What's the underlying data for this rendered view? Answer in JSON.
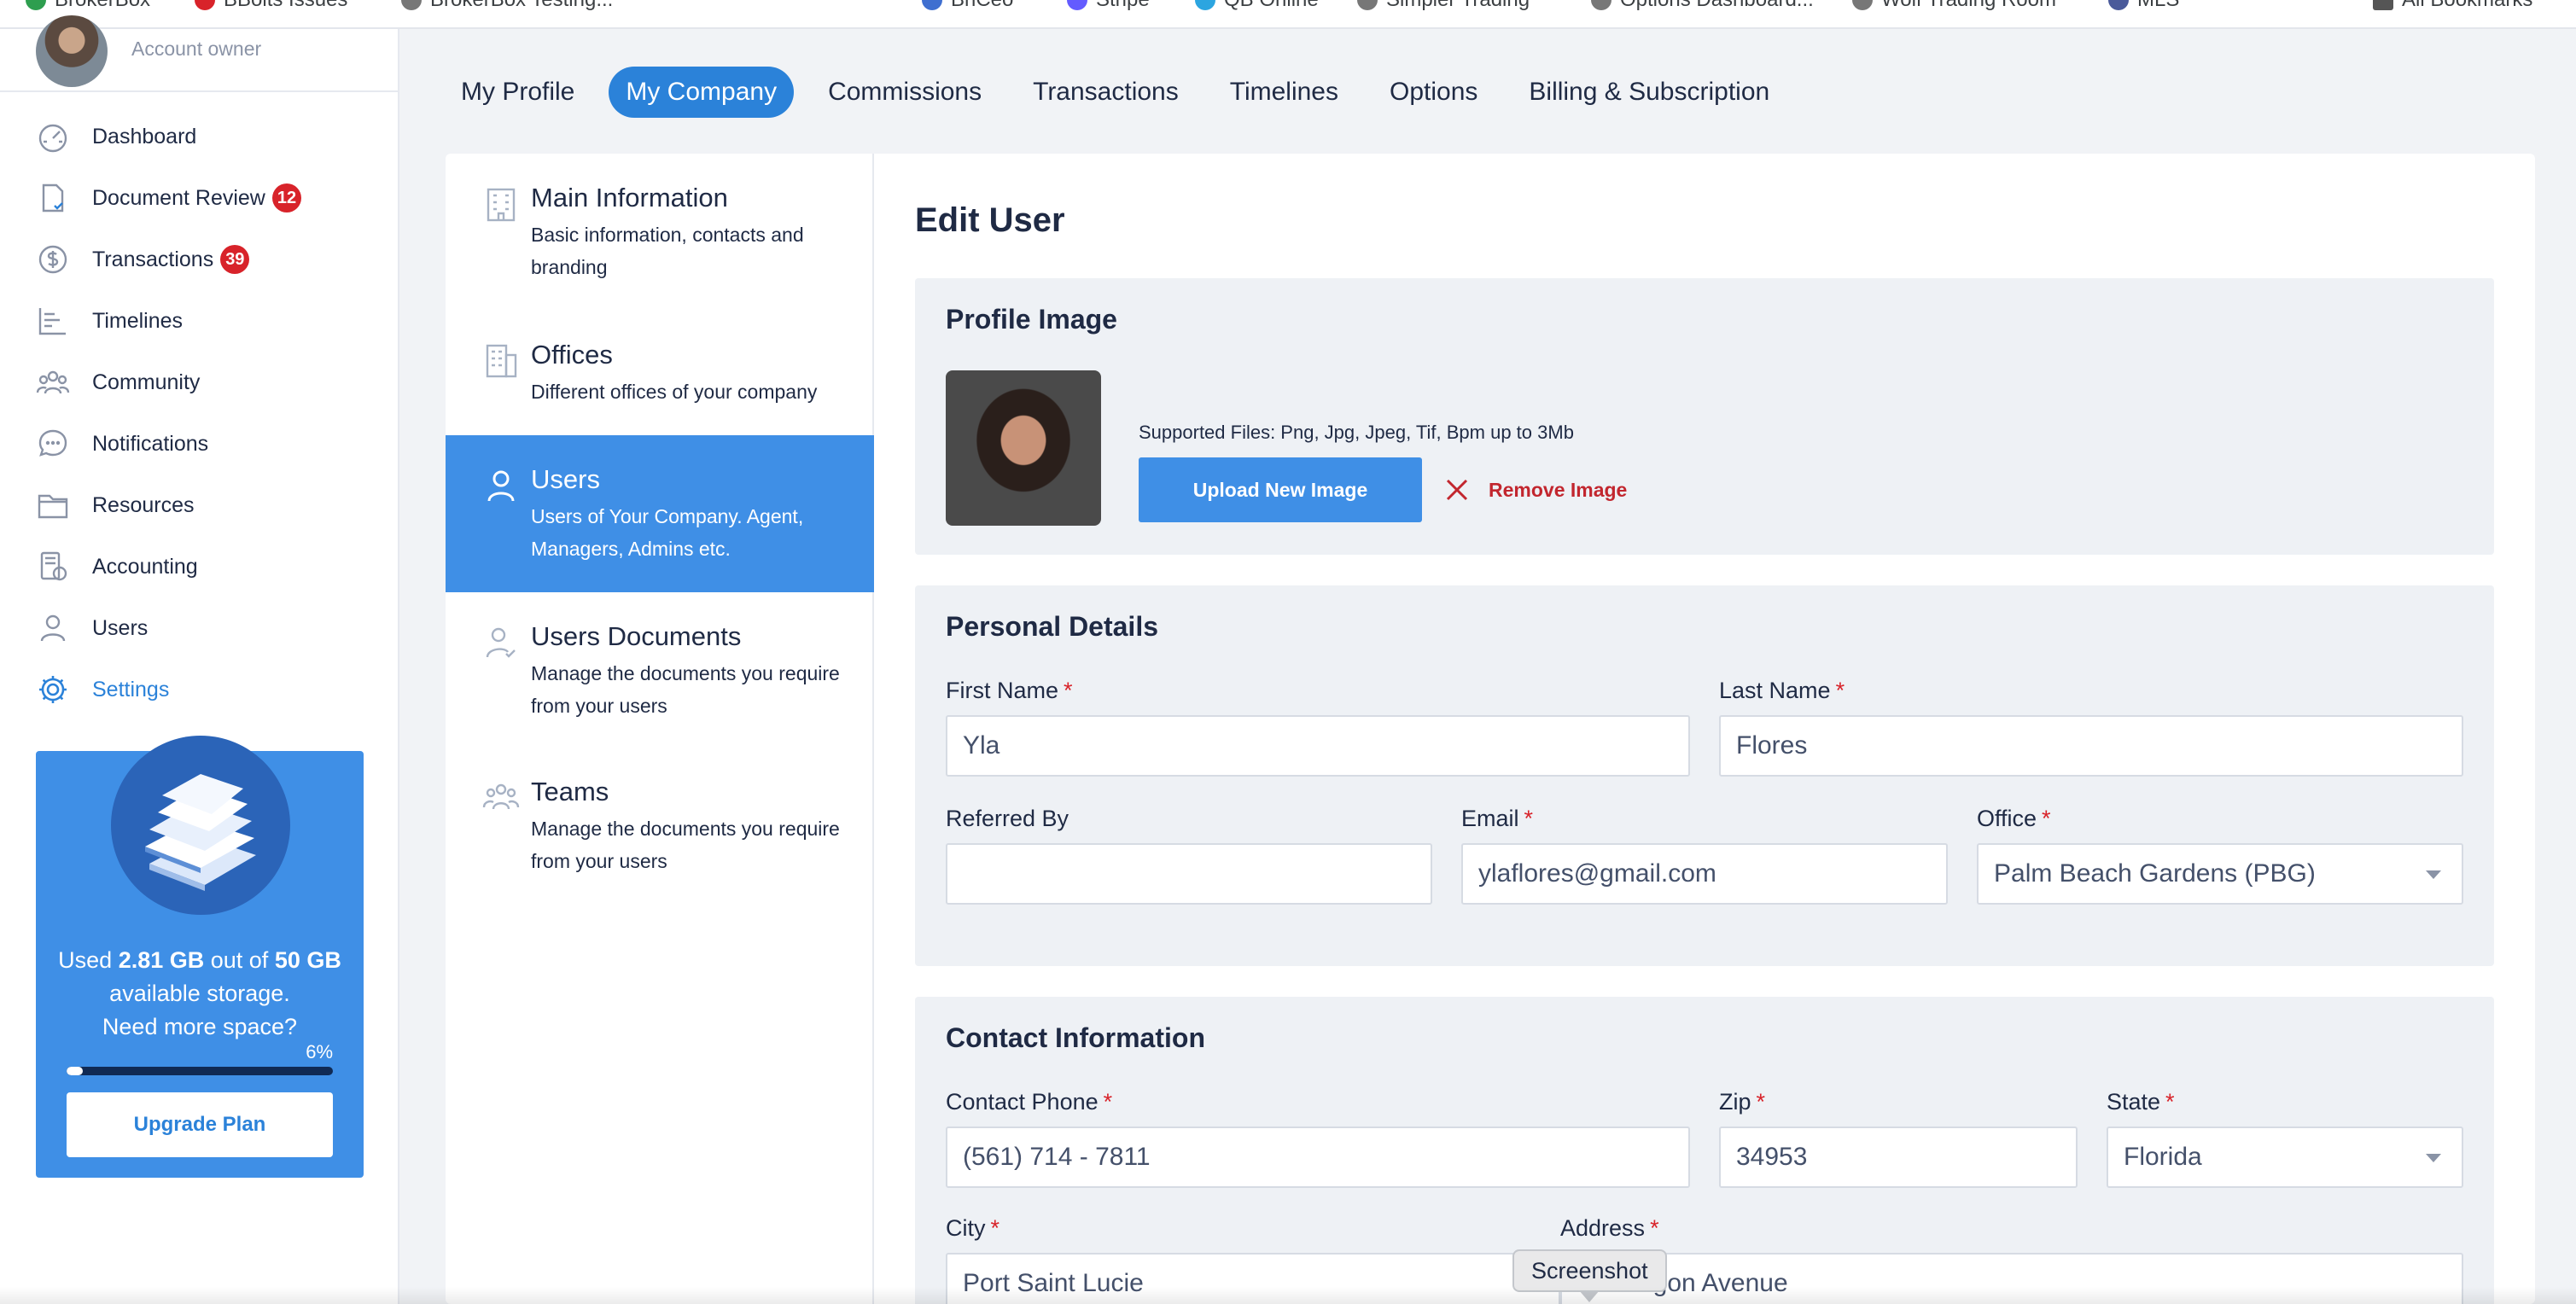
{
  "bookmarks": [
    "BrokerBox",
    "BBolts Issues",
    "BrokerBox Testing...",
    "BriCeo",
    "Stripe",
    "QB Online",
    "Simpler Trading",
    "Options Dashboard...",
    "Wolf Trading Room",
    "MLS",
    "All Bookmarks"
  ],
  "sidebar": {
    "account_role": "Account owner",
    "items": [
      {
        "label": "Dashboard",
        "icon": "dashboard-icon"
      },
      {
        "label": "Document Review",
        "icon": "document-check-icon",
        "badge": "12"
      },
      {
        "label": "Transactions",
        "icon": "dollar-icon",
        "badge": "39"
      },
      {
        "label": "Timelines",
        "icon": "timeline-icon"
      },
      {
        "label": "Community",
        "icon": "community-icon"
      },
      {
        "label": "Notifications",
        "icon": "chat-bubble-icon"
      },
      {
        "label": "Resources",
        "icon": "folder-icon"
      },
      {
        "label": "Accounting",
        "icon": "accounting-icon"
      },
      {
        "label": "Users",
        "icon": "user-icon"
      },
      {
        "label": "Settings",
        "icon": "gear-icon",
        "active": true
      }
    ],
    "storage": {
      "used_prefix": "Used ",
      "used": "2.81 GB",
      "of_text": " out of ",
      "total": "50 GB",
      "suffix": " available storage.",
      "need_more": "Need more space?",
      "percent_label": "6%",
      "percent": 6,
      "upgrade_label": "Upgrade Plan"
    }
  },
  "tabs": [
    {
      "label": "My Profile"
    },
    {
      "label": "My Company",
      "active": true
    },
    {
      "label": "Commissions"
    },
    {
      "label": "Transactions"
    },
    {
      "label": "Timelines"
    },
    {
      "label": "Options"
    },
    {
      "label": "Billing & Subscription"
    }
  ],
  "subnav": [
    {
      "title": "Main Information",
      "desc": "Basic information, contacts and branding",
      "icon": "building-icon"
    },
    {
      "title": "Offices",
      "desc": "Different offices of your company",
      "icon": "office-icon"
    },
    {
      "title": "Users",
      "desc": "Users of Your Company. Agent, Managers, Admins etc.",
      "icon": "user-icon",
      "active": true
    },
    {
      "title": "Users Documents",
      "desc": "Manage the documents you require from your users",
      "icon": "user-document-icon"
    },
    {
      "title": "Teams",
      "desc": "Manage the documents you require from your users",
      "icon": "team-icon"
    }
  ],
  "edit": {
    "title": "Edit User",
    "profile_image": {
      "title": "Profile Image",
      "supported": "Supported Files: Png, Jpg, Jpeg, Tif, Bpm up to 3Mb",
      "upload_label": "Upload New Image",
      "remove_label": "Remove Image"
    },
    "personal": {
      "title": "Personal Details",
      "first_name_label": "First Name",
      "first_name": "Yla",
      "last_name_label": "Last Name",
      "last_name": "Flores",
      "referred_by_label": "Referred By",
      "referred_by": "",
      "email_label": "Email",
      "email": "ylaflores@gmail.com",
      "office_label": "Office",
      "office": "Palm Beach Gardens (PBG)"
    },
    "contact": {
      "title": "Contact Information",
      "phone_label": "Contact Phone",
      "phone": "(561) 714 - 7811",
      "zip_label": "Zip",
      "zip": "34953",
      "state_label": "State",
      "state": "Florida",
      "city_label": "City",
      "city": "Port Saint Lucie",
      "address_label": "Address",
      "address": "Aragon Avenue"
    },
    "required_mark": "*"
  },
  "tooltip": "Screenshot",
  "colors": {
    "accent": "#3f8fe6",
    "tab_active": "#2b82d9",
    "danger": "#d8232a"
  }
}
